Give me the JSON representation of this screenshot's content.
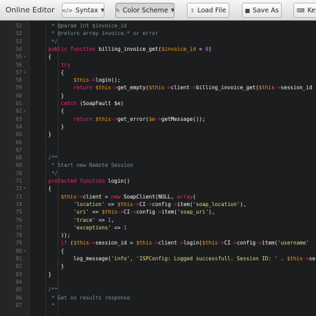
{
  "app": {
    "title": "Online Editor"
  },
  "toolbar": {
    "buttons": [
      {
        "label": "Syntax",
        "icon": "code-icon",
        "dropdown": true
      },
      {
        "label": "Color Scheme",
        "icon": "edit-icon",
        "dropdown": true,
        "active": true
      },
      {
        "label": "Load File",
        "icon": "upload-icon"
      },
      {
        "label": "Save As",
        "icon": "save-icon"
      },
      {
        "label": "Key",
        "icon": "keyboard-icon"
      }
    ]
  },
  "theme": {
    "background": "#1b1d1e",
    "keyword": "#f92672",
    "string": "#e6db74",
    "variable": "#fd971f",
    "comment": "#7e8f94",
    "number": "#ae81ff"
  },
  "editor": {
    "lines": [
      {
        "n": "52",
        "fold": "",
        "segs": [
          [
            "com",
            "     * @param int $invoice_id"
          ]
        ]
      },
      {
        "n": "53",
        "fold": "",
        "segs": [
          [
            "com",
            "     * @return array invoice.* or error"
          ]
        ]
      },
      {
        "n": "53",
        "fold": "",
        "segs": [
          [
            "com",
            "     */"
          ]
        ]
      },
      {
        "n": "54",
        "fold": "",
        "segs": [
          [
            "kw",
            "    public function "
          ],
          [
            "fn",
            "billing_invoice_get"
          ],
          [
            "pl",
            "("
          ],
          [
            "var",
            "$invoice_id"
          ],
          [
            "pl",
            " = "
          ],
          [
            "num",
            "0"
          ],
          [
            "pl",
            ")"
          ]
        ]
      },
      {
        "n": "55",
        "fold": "▾",
        "segs": [
          [
            "pl",
            "    {"
          ]
        ]
      },
      {
        "n": "56",
        "fold": "",
        "segs": [
          [
            "kw",
            "        try"
          ]
        ]
      },
      {
        "n": "57",
        "fold": "▾",
        "segs": [
          [
            "pl",
            "        {"
          ]
        ]
      },
      {
        "n": "58",
        "fold": "",
        "segs": [
          [
            "var",
            "            $this"
          ],
          [
            "op",
            "->"
          ],
          [
            "fn",
            "login"
          ],
          [
            "pl",
            "();"
          ]
        ]
      },
      {
        "n": "59",
        "fold": "",
        "segs": [
          [
            "kw",
            "            return "
          ],
          [
            "var",
            "$this"
          ],
          [
            "op",
            "->"
          ],
          [
            "pl",
            "get_empty("
          ],
          [
            "var",
            "$this"
          ],
          [
            "op",
            "->"
          ],
          [
            "pl",
            "client"
          ],
          [
            "op",
            "->"
          ],
          [
            "pl",
            "billing_invoice_get("
          ],
          [
            "var",
            "$this"
          ],
          [
            "op",
            "->"
          ],
          [
            "pl",
            "session_id"
          ]
        ]
      },
      {
        "n": "60",
        "fold": "",
        "segs": [
          [
            "pl",
            "        }"
          ]
        ]
      },
      {
        "n": "61",
        "fold": "",
        "segs": [
          [
            "kw",
            "        catch "
          ],
          [
            "pl",
            "(SoapFault $e)"
          ]
        ]
      },
      {
        "n": "62",
        "fold": "▾",
        "segs": [
          [
            "pl",
            "        {"
          ]
        ]
      },
      {
        "n": "63",
        "fold": "",
        "segs": [
          [
            "kw",
            "            return "
          ],
          [
            "var",
            "$this"
          ],
          [
            "op",
            "->"
          ],
          [
            "pl",
            "get_error("
          ],
          [
            "var",
            "$e"
          ],
          [
            "op",
            "->"
          ],
          [
            "pl",
            "getMessage());"
          ]
        ]
      },
      {
        "n": "64",
        "fold": "",
        "segs": [
          [
            "pl",
            "        }"
          ]
        ]
      },
      {
        "n": "65",
        "fold": "",
        "segs": [
          [
            "pl",
            "    }"
          ]
        ]
      },
      {
        "n": "66",
        "fold": "",
        "segs": []
      },
      {
        "n": "67",
        "fold": "",
        "segs": []
      },
      {
        "n": "68",
        "fold": "",
        "segs": [
          [
            "com",
            "    /**"
          ]
        ]
      },
      {
        "n": "69",
        "fold": "",
        "segs": [
          [
            "com",
            "     * Start new Remote Session"
          ]
        ]
      },
      {
        "n": "70",
        "fold": "",
        "segs": [
          [
            "com",
            "     */"
          ]
        ]
      },
      {
        "n": "71",
        "fold": "",
        "segs": [
          [
            "kw",
            "    protected function "
          ],
          [
            "fn",
            "login"
          ],
          [
            "pl",
            "()"
          ]
        ]
      },
      {
        "n": "72",
        "fold": "▾",
        "segs": [
          [
            "pl",
            "    {"
          ]
        ]
      },
      {
        "n": "73",
        "fold": "",
        "segs": [
          [
            "var",
            "        $this"
          ],
          [
            "op",
            "->"
          ],
          [
            "pl",
            "client = "
          ],
          [
            "kw",
            "new "
          ],
          [
            "fn",
            "SoapClient"
          ],
          [
            "pl",
            "(NULL, "
          ],
          [
            "kw",
            "array"
          ],
          [
            "pl",
            "("
          ]
        ]
      },
      {
        "n": "74",
        "fold": "",
        "segs": [
          [
            "str",
            "            'location'"
          ],
          [
            "pl",
            " => "
          ],
          [
            "var",
            "$this"
          ],
          [
            "op",
            "->"
          ],
          [
            "pl",
            "CI"
          ],
          [
            "op",
            "->"
          ],
          [
            "pl",
            "config"
          ],
          [
            "op",
            "->"
          ],
          [
            "pl",
            "item("
          ],
          [
            "str",
            "'soap_location'"
          ],
          [
            "pl",
            "),"
          ]
        ]
      },
      {
        "n": "75",
        "fold": "",
        "segs": [
          [
            "str",
            "            'uri'"
          ],
          [
            "pl",
            " => "
          ],
          [
            "var",
            "$this"
          ],
          [
            "op",
            "->"
          ],
          [
            "pl",
            "CI"
          ],
          [
            "op",
            "->"
          ],
          [
            "pl",
            "config"
          ],
          [
            "op",
            "->"
          ],
          [
            "pl",
            "item("
          ],
          [
            "str",
            "'soap_uri'"
          ],
          [
            "pl",
            "),"
          ]
        ]
      },
      {
        "n": "76",
        "fold": "",
        "segs": [
          [
            "str",
            "            'trace'"
          ],
          [
            "pl",
            " => "
          ],
          [
            "num",
            "1"
          ],
          [
            "pl",
            ","
          ]
        ]
      },
      {
        "n": "77",
        "fold": "",
        "segs": [
          [
            "str",
            "            'exceptions'"
          ],
          [
            "pl",
            " => "
          ],
          [
            "num",
            "1"
          ]
        ]
      },
      {
        "n": "78",
        "fold": "",
        "segs": [
          [
            "pl",
            "        ));"
          ]
        ]
      },
      {
        "n": "79",
        "fold": "",
        "segs": [
          [
            "kw",
            "        if "
          ],
          [
            "pl",
            "("
          ],
          [
            "var",
            "$this"
          ],
          [
            "op",
            "->"
          ],
          [
            "pl",
            "session_id = "
          ],
          [
            "var",
            "$this"
          ],
          [
            "op",
            "->"
          ],
          [
            "pl",
            "client"
          ],
          [
            "op",
            "->"
          ],
          [
            "pl",
            "login("
          ],
          [
            "var",
            "$this"
          ],
          [
            "op",
            "->"
          ],
          [
            "pl",
            "CI"
          ],
          [
            "op",
            "->"
          ],
          [
            "pl",
            "config"
          ],
          [
            "op",
            "->"
          ],
          [
            "pl",
            "item("
          ],
          [
            "str",
            "'username'"
          ]
        ]
      },
      {
        "n": "80",
        "fold": "▾",
        "segs": [
          [
            "pl",
            "        {"
          ]
        ]
      },
      {
        "n": "81",
        "fold": "",
        "segs": [
          [
            "pl",
            "            log_message("
          ],
          [
            "str",
            "'info'"
          ],
          [
            "pl",
            ", "
          ],
          [
            "str",
            "'ISPConfig: Logged successfull. Session ID: '"
          ],
          [
            "pl",
            " . "
          ],
          [
            "var",
            "$this"
          ],
          [
            "op",
            "->"
          ],
          [
            "pl",
            "se"
          ]
        ]
      },
      {
        "n": "82",
        "fold": "",
        "segs": [
          [
            "pl",
            "        }"
          ]
        ]
      },
      {
        "n": "83",
        "fold": "",
        "segs": [
          [
            "pl",
            "    }"
          ]
        ]
      },
      {
        "n": "84",
        "fold": "",
        "segs": []
      },
      {
        "n": "85",
        "fold": "",
        "segs": [
          [
            "com",
            "    /**"
          ]
        ]
      },
      {
        "n": "86",
        "fold": "",
        "segs": [
          [
            "com",
            "     * Get no results response"
          ]
        ]
      },
      {
        "n": "87",
        "fold": "",
        "segs": [
          [
            "com",
            "     *"
          ]
        ]
      }
    ]
  }
}
